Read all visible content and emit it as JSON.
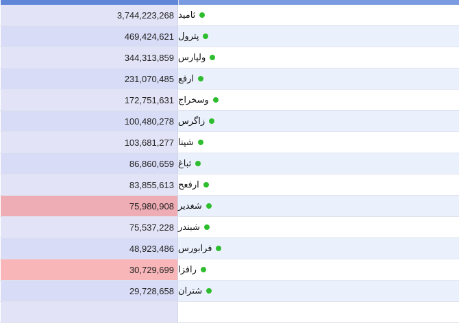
{
  "table": {
    "rows": [
      {
        "name": "ثامید",
        "value": "3,744,223,268",
        "highlight": ""
      },
      {
        "name": "پترول",
        "value": "469,424,621",
        "highlight": ""
      },
      {
        "name": "ولپارس",
        "value": "344,313,859",
        "highlight": ""
      },
      {
        "name": "ارفع",
        "value": "231,070,485",
        "highlight": ""
      },
      {
        "name": "وسخراج",
        "value": "172,751,631",
        "highlight": ""
      },
      {
        "name": "زاگرس",
        "value": "100,480,278",
        "highlight": ""
      },
      {
        "name": "شپنا",
        "value": "103,681,277",
        "highlight": ""
      },
      {
        "name": "ثباغ",
        "value": "86,860,659",
        "highlight": ""
      },
      {
        "name": "ارفعح",
        "value": "83,855,613",
        "highlight": ""
      },
      {
        "name": "شغدیر",
        "value": "75,980,908",
        "highlight": "dark"
      },
      {
        "name": "شبندر",
        "value": "75,537,228",
        "highlight": ""
      },
      {
        "name": "فرابورس",
        "value": "48,923,486",
        "highlight": ""
      },
      {
        "name": "رافزا",
        "value": "30,729,699",
        "highlight": "light"
      },
      {
        "name": "شتران",
        "value": "29,728,658",
        "highlight": ""
      },
      {
        "name": "",
        "value": "",
        "highlight": ""
      }
    ]
  },
  "colors": {
    "status_dot": "#2ebd2e",
    "header_value_bg": "#5f86d8",
    "header_name_bg": "#7a9bdf",
    "highlight_dark": "#eeacb4",
    "highlight_light": "#f8b6b8"
  },
  "icons": {
    "status": "green-dot-icon"
  }
}
